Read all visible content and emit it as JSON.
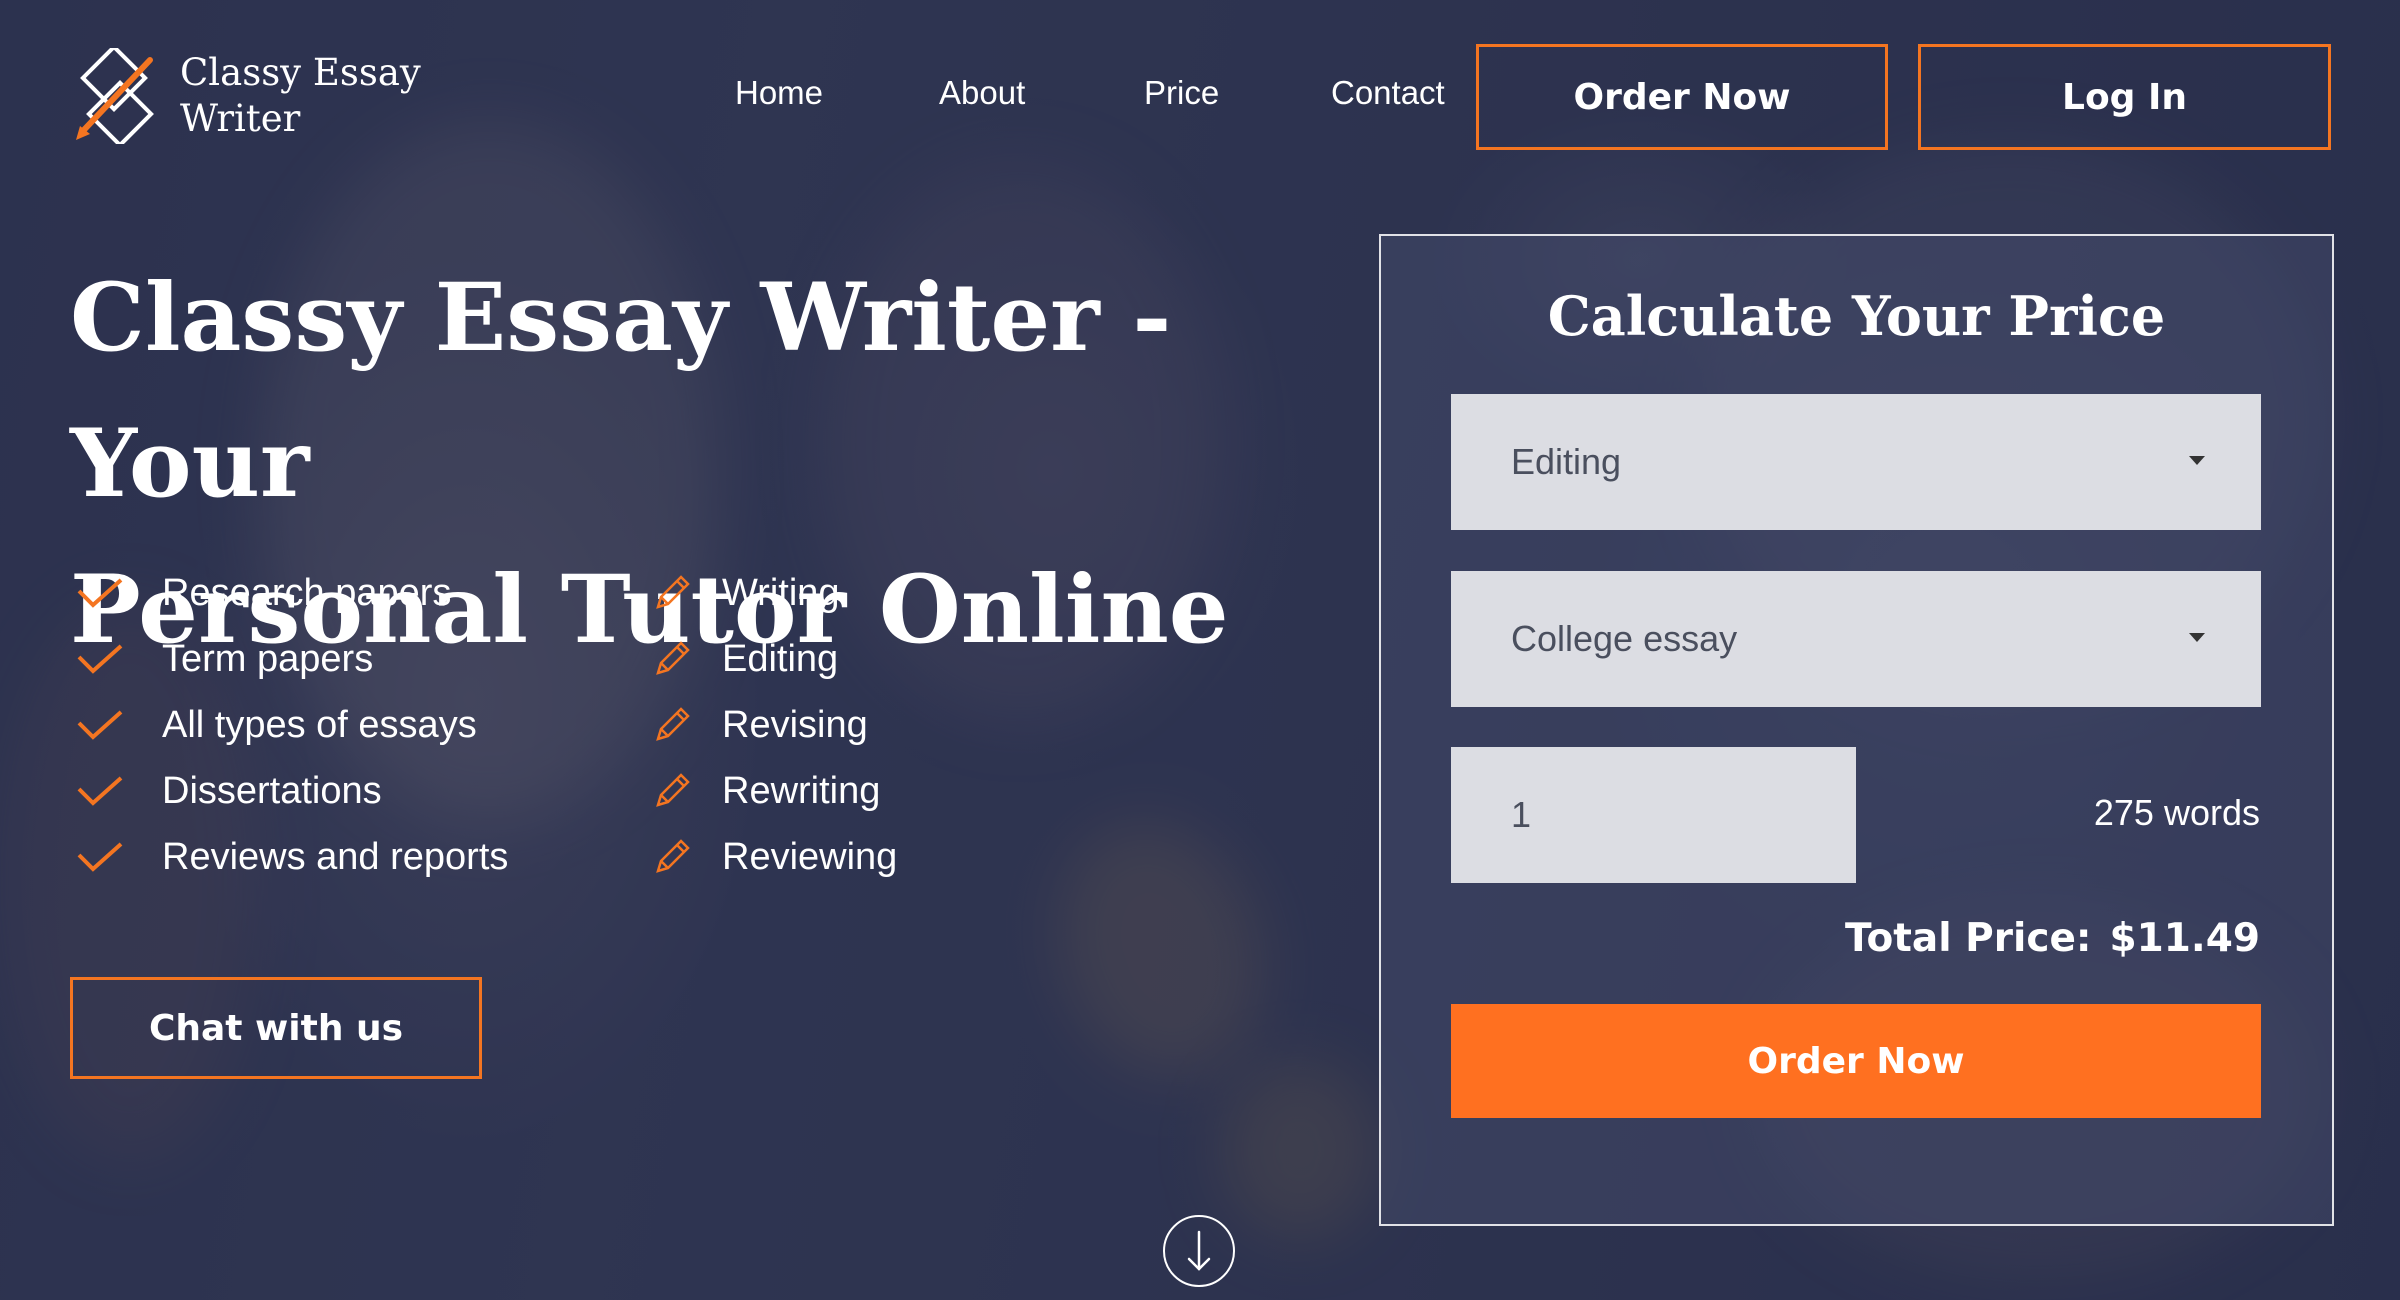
{
  "logo": {
    "line1": "Classy Essay",
    "line2": "Writer"
  },
  "nav": {
    "home": "Home",
    "about": "About",
    "price": "Price",
    "contact": "Contact"
  },
  "header_buttons": {
    "order_now": "Order Now",
    "log_in": "Log In"
  },
  "hero": {
    "title_line1": "Classy Essay Writer - Your",
    "title_line2": "Personal Tutor Online"
  },
  "paper_types": [
    "Research papers",
    "Term papers",
    "All types of essays",
    "Dissertations",
    "Reviews and reports"
  ],
  "services": [
    "Writing",
    "Editing",
    "Revising",
    "Rewriting",
    "Reviewing"
  ],
  "chat_button": "Chat with us",
  "calculator": {
    "title": "Calculate Your Price",
    "service_select": "Editing",
    "type_select": "College essay",
    "pages_value": "1",
    "words": "275 words",
    "total_label": "Total Price:",
    "total_value": "$11.49",
    "order_button": "Order Now"
  },
  "colors": {
    "accent": "#ff7020",
    "outline": "#f47521",
    "overlay": "#2f3551"
  }
}
